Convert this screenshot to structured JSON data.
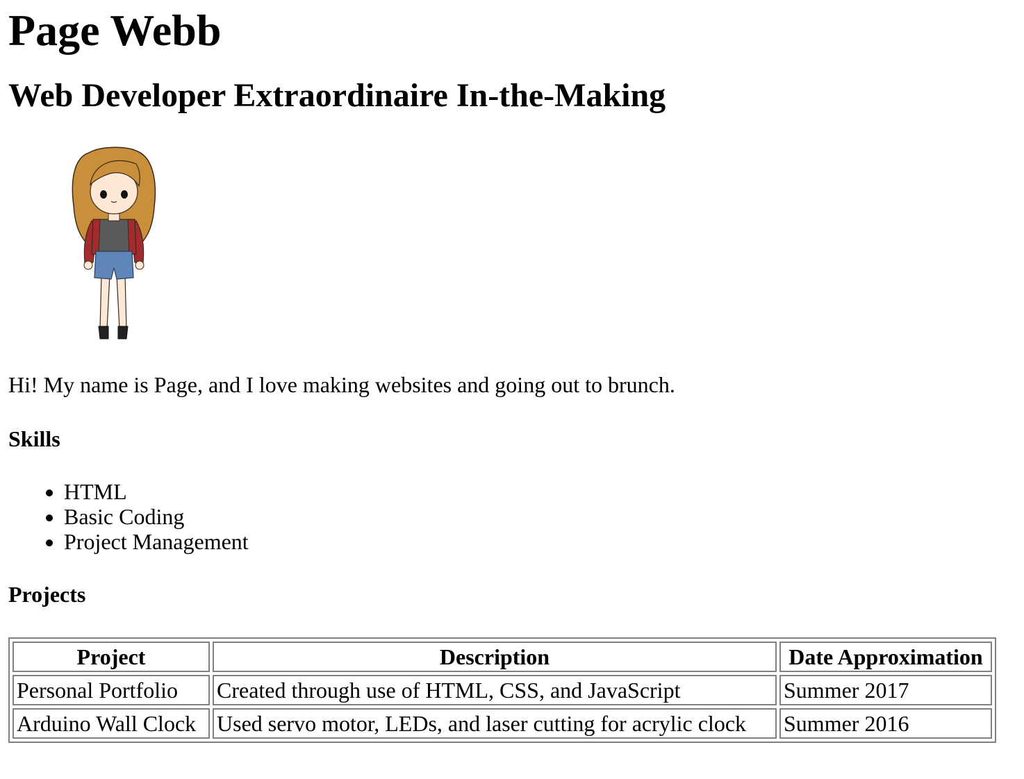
{
  "header": {
    "name": "Page Webb",
    "tagline": "Web Developer Extraordinaire In-the-Making"
  },
  "avatar": {
    "icon": "cartoon-girl-avatar"
  },
  "intro": "Hi! My name is Page, and I love making websites and going out to brunch.",
  "skills": {
    "heading": "Skills",
    "items": [
      "HTML",
      "Basic Coding",
      "Project Management"
    ]
  },
  "projects": {
    "heading": "Projects",
    "columns": [
      "Project",
      "Description",
      "Date Approximation"
    ],
    "rows": [
      [
        "Personal Portfolio",
        "Created through use of HTML, CSS, and JavaScript",
        "Summer 2017"
      ],
      [
        "Arduino Wall Clock",
        "Used servo motor, LEDs, and laser cutting for acrylic clock",
        "Summer 2016"
      ]
    ]
  },
  "colors": {
    "hair": "#c98f3a",
    "jacket": "#a32b2e",
    "shirt": "#5b5b5b",
    "shorts": "#5f86b8",
    "skin": "#fde8d6",
    "table_border": "#808080"
  }
}
